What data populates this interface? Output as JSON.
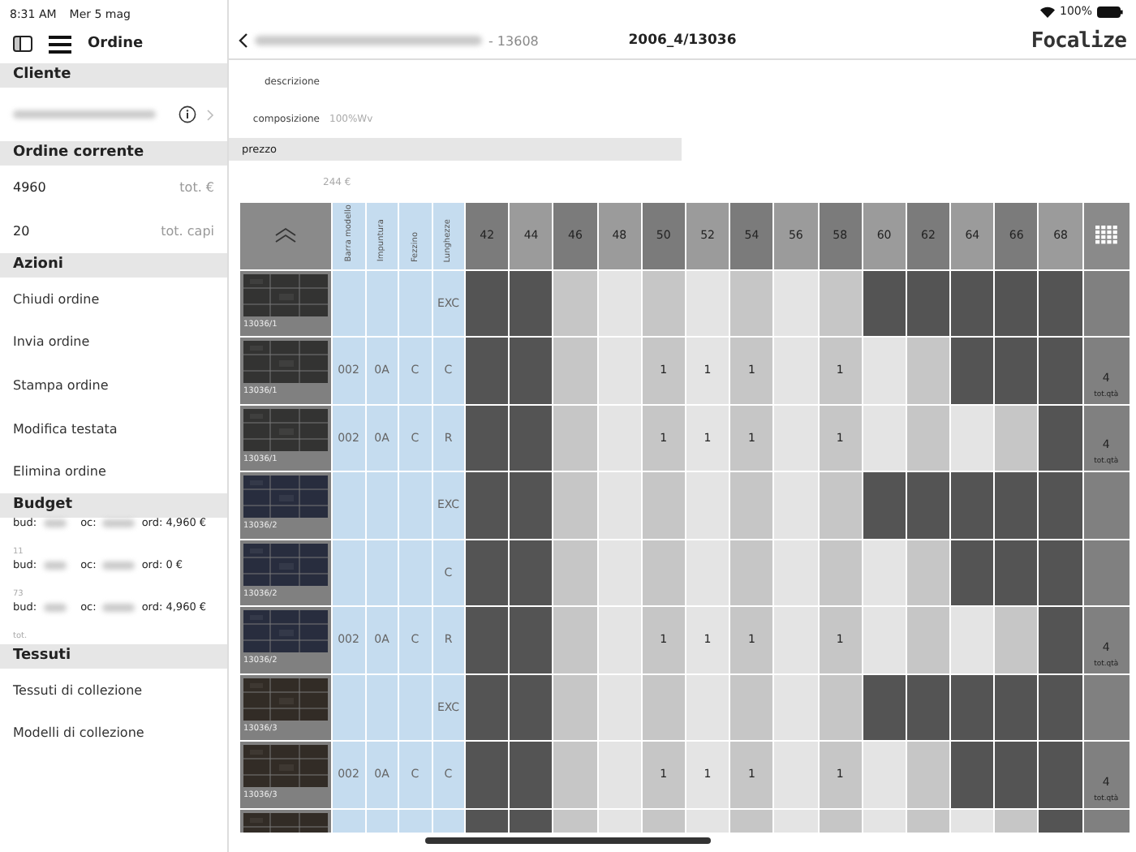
{
  "status_bar": {
    "time": "8:31 AM",
    "date": "Mer 5 mag",
    "battery": "100%"
  },
  "sidebar": {
    "title": "Ordine",
    "sections": [
      {
        "title": "Cliente",
        "kind": "client"
      },
      {
        "title": "Ordine corrente",
        "kind": "totals",
        "items": [
          {
            "value": "4960",
            "label": "tot. €"
          },
          {
            "value": "20",
            "label": "tot. capi"
          }
        ]
      },
      {
        "title": "Azioni",
        "kind": "links",
        "items": [
          {
            "label": "Chiudi ordine"
          },
          {
            "label": "Invia ordine"
          },
          {
            "label": "Stampa ordine"
          },
          {
            "label": "Modifica testata"
          },
          {
            "label": "Elimina ordine"
          }
        ]
      },
      {
        "title": "Budget",
        "kind": "budget",
        "items": [
          {
            "bud": "bud:",
            "oc": "oc:",
            "ord": "ord: 4,960 €",
            "sub": "11"
          },
          {
            "bud": "bud:",
            "oc": "oc:",
            "ord": "ord: 0 €",
            "sub": "73"
          },
          {
            "bud": "bud:",
            "oc": "oc:",
            "ord": "ord: 4,960 €",
            "sub": "tot."
          }
        ]
      },
      {
        "title": "Tessuti",
        "kind": "links",
        "items": [
          {
            "label": "Tessuti di collezione"
          },
          {
            "label": "Modelli di collezione"
          }
        ]
      }
    ]
  },
  "navbar": {
    "back_suffix": "- 13608",
    "title": "2006_4/13036",
    "logo": "Focalize"
  },
  "details": {
    "descrizione_label": "descrizione",
    "composizione_label": "composizione",
    "composizione": "100%Wv",
    "prezzo_label": "prezzo",
    "prezzo": "244 €"
  },
  "grid": {
    "option_columns": [
      "Barra modello",
      "Impuntura",
      "Fezzino",
      "Lunghezze"
    ],
    "sizes": [
      "42",
      "44",
      "46",
      "48",
      "50",
      "52",
      "54",
      "56",
      "58",
      "60",
      "62",
      "64",
      "66",
      "68"
    ],
    "rows": [
      {
        "code": "13036/1",
        "color": "#3d3d3b",
        "options": [
          {
            "kind": "blank"
          },
          {
            "kind": "blank"
          },
          {
            "kind": "blank"
          },
          {
            "kind": "text",
            "text": "EXC"
          }
        ],
        "cells": [
          {
            "kind": "unavailable"
          },
          {
            "kind": "unavailable"
          },
          {
            "kind": "available"
          },
          {
            "kind": "available"
          },
          {
            "kind": "available"
          },
          {
            "kind": "available"
          },
          {
            "kind": "available"
          },
          {
            "kind": "available"
          },
          {
            "kind": "available"
          },
          {
            "kind": "unavailable"
          },
          {
            "kind": "unavailable"
          },
          {
            "kind": "unavailable"
          },
          {
            "kind": "unavailable"
          },
          {
            "kind": "unavailable"
          }
        ]
      },
      {
        "code": "13036/1",
        "color": "#3d3d3b",
        "options": [
          {
            "kind": "text",
            "text": "002"
          },
          {
            "kind": "text",
            "text": "0A"
          },
          {
            "kind": "text",
            "text": "C"
          },
          {
            "kind": "text",
            "text": "C"
          }
        ],
        "cells": [
          {
            "kind": "unavailable"
          },
          {
            "kind": "unavailable"
          },
          {
            "kind": "available"
          },
          {
            "kind": "available"
          },
          {
            "kind": "available",
            "qty": "1"
          },
          {
            "kind": "available",
            "qty": "1"
          },
          {
            "kind": "available",
            "qty": "1"
          },
          {
            "kind": "available"
          },
          {
            "kind": "available",
            "qty": "1"
          },
          {
            "kind": "available"
          },
          {
            "kind": "available"
          },
          {
            "kind": "unavailable"
          },
          {
            "kind": "unavailable"
          },
          {
            "kind": "unavailable"
          }
        ],
        "total": "4",
        "total_label": "tot.qtà"
      },
      {
        "code": "13036/1",
        "color": "#3d3d3b",
        "options": [
          {
            "kind": "text",
            "text": "002"
          },
          {
            "kind": "text",
            "text": "0A"
          },
          {
            "kind": "text",
            "text": "C"
          },
          {
            "kind": "text",
            "text": "R"
          }
        ],
        "cells": [
          {
            "kind": "unavailable"
          },
          {
            "kind": "unavailable"
          },
          {
            "kind": "available"
          },
          {
            "kind": "available"
          },
          {
            "kind": "available",
            "qty": "1"
          },
          {
            "kind": "available",
            "qty": "1"
          },
          {
            "kind": "available",
            "qty": "1"
          },
          {
            "kind": "available"
          },
          {
            "kind": "available",
            "qty": "1"
          },
          {
            "kind": "available"
          },
          {
            "kind": "available"
          },
          {
            "kind": "available"
          },
          {
            "kind": "available"
          },
          {
            "kind": "unavailable"
          }
        ],
        "total": "4",
        "total_label": "tot.qtà"
      },
      {
        "code": "13036/2",
        "color": "#2f3649",
        "options": [
          {
            "kind": "blank"
          },
          {
            "kind": "blank"
          },
          {
            "kind": "blank"
          },
          {
            "kind": "text",
            "text": "EXC"
          }
        ],
        "cells": [
          {
            "kind": "unavailable"
          },
          {
            "kind": "unavailable"
          },
          {
            "kind": "available"
          },
          {
            "kind": "available"
          },
          {
            "kind": "available"
          },
          {
            "kind": "available"
          },
          {
            "kind": "available"
          },
          {
            "kind": "available"
          },
          {
            "kind": "available"
          },
          {
            "kind": "unavailable"
          },
          {
            "kind": "unavailable"
          },
          {
            "kind": "unavailable"
          },
          {
            "kind": "unavailable"
          },
          {
            "kind": "unavailable"
          }
        ]
      },
      {
        "code": "13036/2",
        "color": "#2f3649",
        "options": [
          {
            "kind": "blank"
          },
          {
            "kind": "blank"
          },
          {
            "kind": "blank"
          },
          {
            "kind": "text",
            "text": "C"
          }
        ],
        "cells": [
          {
            "kind": "unavailable"
          },
          {
            "kind": "unavailable"
          },
          {
            "kind": "available"
          },
          {
            "kind": "available"
          },
          {
            "kind": "available"
          },
          {
            "kind": "available"
          },
          {
            "kind": "available"
          },
          {
            "kind": "available"
          },
          {
            "kind": "available"
          },
          {
            "kind": "available"
          },
          {
            "kind": "available"
          },
          {
            "kind": "unavailable"
          },
          {
            "kind": "unavailable"
          },
          {
            "kind": "unavailable"
          }
        ]
      },
      {
        "code": "13036/2",
        "color": "#2f3649",
        "options": [
          {
            "kind": "text",
            "text": "002"
          },
          {
            "kind": "text",
            "text": "0A"
          },
          {
            "kind": "text",
            "text": "C"
          },
          {
            "kind": "text",
            "text": "R"
          }
        ],
        "cells": [
          {
            "kind": "unavailable"
          },
          {
            "kind": "unavailable"
          },
          {
            "kind": "available"
          },
          {
            "kind": "available"
          },
          {
            "kind": "available",
            "qty": "1"
          },
          {
            "kind": "available",
            "qty": "1"
          },
          {
            "kind": "available",
            "qty": "1"
          },
          {
            "kind": "available"
          },
          {
            "kind": "available",
            "qty": "1"
          },
          {
            "kind": "available"
          },
          {
            "kind": "available"
          },
          {
            "kind": "available"
          },
          {
            "kind": "available"
          },
          {
            "kind": "unavailable"
          }
        ],
        "total": "4",
        "total_label": "tot.qtà"
      },
      {
        "code": "13036/3",
        "color": "#3b342d",
        "options": [
          {
            "kind": "blank"
          },
          {
            "kind": "blank"
          },
          {
            "kind": "blank"
          },
          {
            "kind": "text",
            "text": "EXC"
          }
        ],
        "cells": [
          {
            "kind": "unavailable"
          },
          {
            "kind": "unavailable"
          },
          {
            "kind": "available"
          },
          {
            "kind": "available"
          },
          {
            "kind": "available"
          },
          {
            "kind": "available"
          },
          {
            "kind": "available"
          },
          {
            "kind": "available"
          },
          {
            "kind": "available"
          },
          {
            "kind": "unavailable"
          },
          {
            "kind": "unavailable"
          },
          {
            "kind": "unavailable"
          },
          {
            "kind": "unavailable"
          },
          {
            "kind": "unavailable"
          }
        ]
      },
      {
        "code": "13036/3",
        "color": "#3b342d",
        "options": [
          {
            "kind": "text",
            "text": "002"
          },
          {
            "kind": "text",
            "text": "0A"
          },
          {
            "kind": "text",
            "text": "C"
          },
          {
            "kind": "text",
            "text": "C"
          }
        ],
        "cells": [
          {
            "kind": "unavailable"
          },
          {
            "kind": "unavailable"
          },
          {
            "kind": "available"
          },
          {
            "kind": "available"
          },
          {
            "kind": "available",
            "qty": "1"
          },
          {
            "kind": "available",
            "qty": "1"
          },
          {
            "kind": "available",
            "qty": "1"
          },
          {
            "kind": "available"
          },
          {
            "kind": "available",
            "qty": "1"
          },
          {
            "kind": "available"
          },
          {
            "kind": "available"
          },
          {
            "kind": "unavailable"
          },
          {
            "kind": "unavailable"
          },
          {
            "kind": "unavailable"
          }
        ],
        "total": "4",
        "total_label": "tot.qtà"
      },
      {
        "color": "#3b342d",
        "options": [
          {
            "kind": "blank"
          },
          {
            "kind": "blank"
          },
          {
            "kind": "blank"
          },
          {
            "kind": "blank"
          }
        ],
        "cells": [
          {
            "kind": "unavailable"
          },
          {
            "kind": "unavailable"
          },
          {
            "kind": "available"
          },
          {
            "kind": "available"
          },
          {
            "kind": "available"
          },
          {
            "kind": "available"
          },
          {
            "kind": "available"
          },
          {
            "kind": "available"
          },
          {
            "kind": "available"
          },
          {
            "kind": "available"
          },
          {
            "kind": "available"
          },
          {
            "kind": "available"
          },
          {
            "kind": "available"
          },
          {
            "kind": "unavailable"
          }
        ]
      }
    ]
  }
}
